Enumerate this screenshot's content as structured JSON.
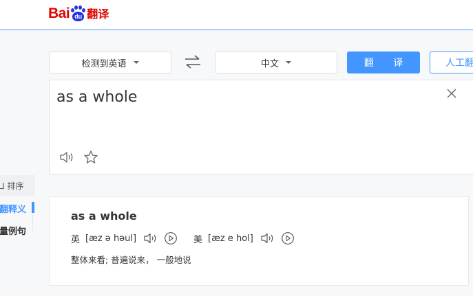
{
  "header": {
    "logo_text": "Bai",
    "logo_paw_text": "du",
    "logo_product": "翻译"
  },
  "toolbar": {
    "source_lang": "检测到英语",
    "swap_icon": "swap-arrows-icon",
    "target_lang": "中文",
    "translate_label": "翻 译",
    "human_label": "人工翻译"
  },
  "input": {
    "text": "as a whole",
    "clear_icon": "close-icon",
    "speak_icon": "speaker-icon",
    "favorite_icon": "star-icon"
  },
  "sidebar": {
    "sort_label": "⅃ 排序",
    "items": [
      {
        "label": "翻释义",
        "active": true
      },
      {
        "label": "量例句",
        "active": false
      }
    ]
  },
  "result": {
    "word": "as a whole",
    "uk": {
      "label": "英",
      "ipa": "[æz ə həul]"
    },
    "us": {
      "label": "美",
      "ipa": "[æz e hol]"
    },
    "meaning": "整体来看;  普遍说来，  一般地说"
  },
  "colors": {
    "accent": "#4395ff",
    "logo_red": "#e10601",
    "logo_blue": "#2932e1"
  }
}
